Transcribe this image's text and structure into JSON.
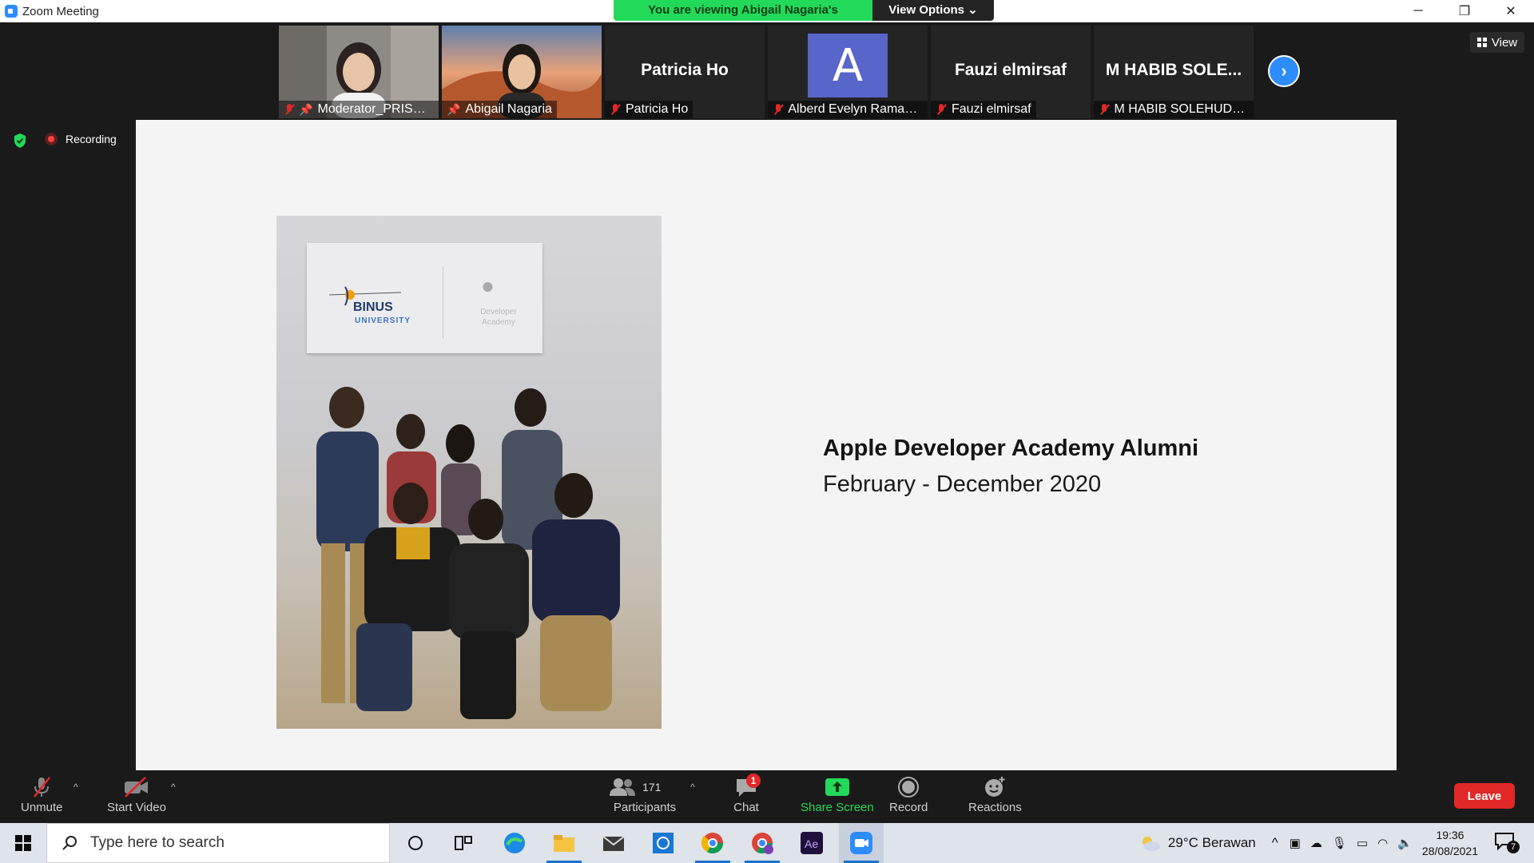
{
  "window": {
    "title": "Zoom Meeting",
    "minimize": "─",
    "restore": "❐",
    "close": "✕"
  },
  "banner": {
    "viewing": "You are viewing Abigail Nagaria's screen",
    "view_options": "View Options ⌄"
  },
  "view_button": "View",
  "participants_strip": [
    {
      "label": "Moderator_PRISCH...",
      "type": "camera"
    },
    {
      "label": "Abigail Nagaria",
      "type": "camera",
      "active": true
    },
    {
      "label": "Patricia Ho",
      "big": "Patricia Ho",
      "type": "name"
    },
    {
      "label": "Alberd Evelyn Ramadh...",
      "avatar": "A",
      "type": "avatar"
    },
    {
      "label": "Fauzi elmirsaf",
      "big": "Fauzi elmirsaf",
      "type": "name"
    },
    {
      "label": "M HABIB SOLEHUDDIN",
      "big": "M HABIB SOLE...",
      "type": "name"
    }
  ],
  "recording": {
    "label": "Recording"
  },
  "slide": {
    "title": "Apple Developer Academy Alumni",
    "subtitle": "February - December 2020",
    "sign_binus": "BINUS",
    "sign_university": "UNIVERSITY",
    "sign_developer": "Developer Academy"
  },
  "toolbar": {
    "unmute": "Unmute",
    "start_video": "Start Video",
    "participants": "Participants",
    "participant_count": "171",
    "chat": "Chat",
    "chat_badge": "1",
    "share_screen": "Share Screen",
    "record": "Record",
    "reactions": "Reactions",
    "leave": "Leave"
  },
  "taskbar": {
    "search_placeholder": "Type here to search",
    "weather": "29°C  Berawan",
    "time": "19:36",
    "date": "28/08/2021",
    "notification_count": "7"
  },
  "colors": {
    "zoom_blue": "#2D8CFF",
    "banner_green": "#23D959",
    "leave_red": "#E02828"
  }
}
